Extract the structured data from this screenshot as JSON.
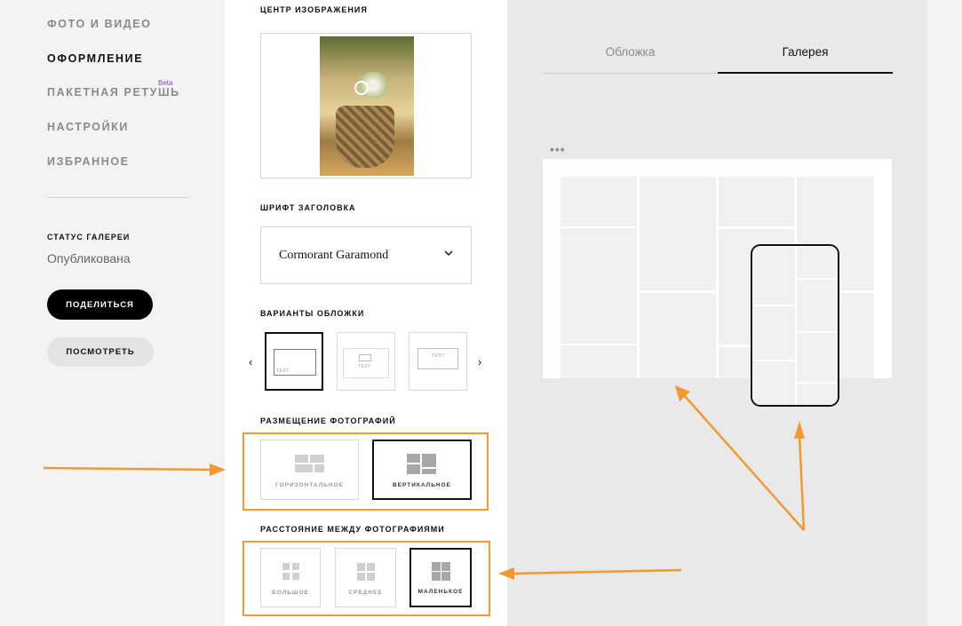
{
  "nav": {
    "items": [
      {
        "label": "ФОТО И ВИДЕО",
        "active": false
      },
      {
        "label": "ОФОРМЛЕНИЕ",
        "active": true
      },
      {
        "label": "ПАКЕТНАЯ РЕТУШЬ",
        "active": false,
        "badge": "Beta"
      },
      {
        "label": "НАСТРОЙКИ",
        "active": false
      },
      {
        "label": "ИЗБРАННОЕ",
        "active": false
      }
    ],
    "status_title": "СТАТУС ГАЛЕРЕИ",
    "status_value": "Опубликована",
    "share_button": "ПОДЕЛИТЬСЯ",
    "view_button": "ПОСМОТРЕТЬ"
  },
  "settings": {
    "image_center_label": "ЦЕНТР ИЗОБРАЖЕНИЯ",
    "font_label": "ШРИФТ ЗАГОЛОВКА",
    "font_value": "Cormorant Garamond",
    "cover_label": "ВАРИАНТЫ ОБЛОЖКИ",
    "cover_text": "TEXT",
    "placement_label": "РАЗМЕЩЕНИЕ ФОТОГРАФИЙ",
    "placement_options": [
      {
        "label": "ГОРИЗОНТАЛЬНОЕ",
        "selected": false
      },
      {
        "label": "ВЕРТИКАЛЬНОЕ",
        "selected": true
      }
    ],
    "spacing_label": "РАССТОЯНИЕ МЕЖДУ ФОТОГРАФИЯМИ",
    "spacing_options": [
      {
        "label": "БОЛЬШОЕ",
        "selected": false
      },
      {
        "label": "СРЕДНЕЕ",
        "selected": false
      },
      {
        "label": "МАЛЕНЬКОЕ",
        "selected": true
      }
    ]
  },
  "preview": {
    "tabs": [
      {
        "label": "Обложка",
        "active": false
      },
      {
        "label": "Галерея",
        "active": true
      }
    ],
    "menu_dots": "•••"
  },
  "colors": {
    "annotation": "#ef9a33",
    "beta": "#8a3ed8"
  },
  "icons": [
    "chevron-down-icon",
    "chevron-left-icon",
    "chevron-right-icon",
    "more-dots-icon"
  ]
}
